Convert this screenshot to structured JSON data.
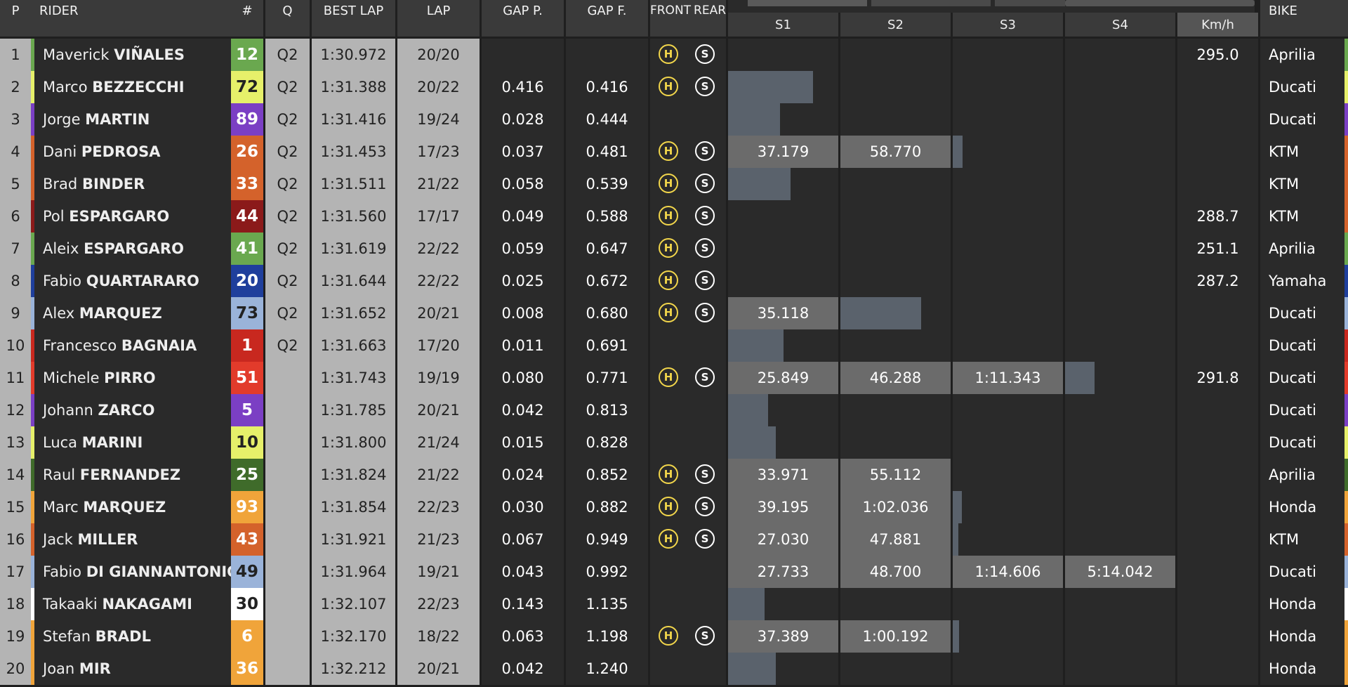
{
  "headers": {
    "p": "P",
    "rider": "RIDER",
    "num": "#",
    "q": "Q",
    "best_lap": "BEST LAP",
    "lap": "LAP",
    "gap_p": "GAP P.",
    "gap_f": "GAP F.",
    "front": "FRONT",
    "rear": "REAR",
    "s1": "S1",
    "s2": "S2",
    "s3": "S3",
    "s4": "S4",
    "kmh": "Km/h",
    "bike": "BIKE"
  },
  "rows": [
    {
      "pos": "1",
      "first": "Maverick",
      "last": "VIÑALES",
      "num": "12",
      "num_bg": "#6aa84f",
      "num_fg": "#ffffff",
      "team_color": "#6aa84f",
      "q": "Q2",
      "best": "1:30.972",
      "lap": "20/20",
      "gap_p": "",
      "gap_f": "",
      "front": "H",
      "rear": "S",
      "s1": "",
      "s2": "",
      "s3": "",
      "s4": "",
      "progress": [
        0,
        0,
        0,
        0
      ],
      "kmh": "295.0",
      "bike": "Aprilia",
      "end_color": "#6aa84f"
    },
    {
      "pos": "2",
      "first": "Marco",
      "last": "BEZZECCHI",
      "num": "72",
      "num_bg": "#e6f06a",
      "num_fg": "#222222",
      "team_color": "#e6f06a",
      "q": "Q2",
      "best": "1:31.388",
      "lap": "20/22",
      "gap_p": "0.416",
      "gap_f": "0.416",
      "front": "H",
      "rear": "S",
      "s1": "",
      "s2": "",
      "s3": "",
      "s4": "",
      "progress": [
        0.77,
        0,
        0,
        0
      ],
      "kmh": "",
      "bike": "Ducati",
      "end_color": "#e6f06a"
    },
    {
      "pos": "3",
      "first": "Jorge",
      "last": "MARTIN",
      "num": "89",
      "num_bg": "#7b3fc4",
      "num_fg": "#ffffff",
      "team_color": "#7b3fc4",
      "q": "Q2",
      "best": "1:31.416",
      "lap": "19/24",
      "gap_p": "0.028",
      "gap_f": "0.444",
      "front": "",
      "rear": "",
      "s1": "",
      "s2": "",
      "s3": "",
      "s4": "",
      "progress": [
        0.47,
        0,
        0,
        0
      ],
      "kmh": "",
      "bike": "Ducati",
      "end_color": "#7b3fc4"
    },
    {
      "pos": "4",
      "first": "Dani",
      "last": "PEDROSA",
      "num": "26",
      "num_bg": "#d4622b",
      "num_fg": "#ffffff",
      "team_color": "#d4622b",
      "q": "Q2",
      "best": "1:31.453",
      "lap": "17/23",
      "gap_p": "0.037",
      "gap_f": "0.481",
      "front": "H",
      "rear": "S",
      "s1": "37.179",
      "s2": "58.770",
      "s3": "",
      "s4": "",
      "progress": [
        1,
        1,
        0.09,
        0
      ],
      "kmh": "",
      "bike": "KTM",
      "end_color": "#d4622b"
    },
    {
      "pos": "5",
      "first": "Brad",
      "last": "BINDER",
      "num": "33",
      "num_bg": "#d4622b",
      "num_fg": "#ffffff",
      "team_color": "#d4622b",
      "q": "Q2",
      "best": "1:31.511",
      "lap": "21/22",
      "gap_p": "0.058",
      "gap_f": "0.539",
      "front": "H",
      "rear": "S",
      "s1": "",
      "s2": "",
      "s3": "",
      "s4": "",
      "progress": [
        0.57,
        0,
        0,
        0
      ],
      "kmh": "",
      "bike": "KTM",
      "end_color": "#d4622b"
    },
    {
      "pos": "6",
      "first": "Pol",
      "last": "ESPARGARO",
      "num": "44",
      "num_bg": "#8b1a1a",
      "num_fg": "#ffffff",
      "team_color": "#8b1a1a",
      "q": "Q2",
      "best": "1:31.560",
      "lap": "17/17",
      "gap_p": "0.049",
      "gap_f": "0.588",
      "front": "H",
      "rear": "S",
      "s1": "",
      "s2": "",
      "s3": "",
      "s4": "",
      "progress": [
        0,
        0,
        0,
        0
      ],
      "kmh": "288.7",
      "bike": "KTM",
      "end_color": "#d4622b"
    },
    {
      "pos": "7",
      "first": "Aleix",
      "last": "ESPARGARO",
      "num": "41",
      "num_bg": "#6aa84f",
      "num_fg": "#ffffff",
      "team_color": "#6aa84f",
      "q": "Q2",
      "best": "1:31.619",
      "lap": "22/22",
      "gap_p": "0.059",
      "gap_f": "0.647",
      "front": "H",
      "rear": "S",
      "s1": "",
      "s2": "",
      "s3": "",
      "s4": "",
      "progress": [
        0,
        0,
        0,
        0
      ],
      "kmh": "251.1",
      "bike": "Aprilia",
      "end_color": "#6aa84f"
    },
    {
      "pos": "8",
      "first": "Fabio",
      "last": "QUARTARARO",
      "num": "20",
      "num_bg": "#1f3f9c",
      "num_fg": "#ffffff",
      "team_color": "#1f3f9c",
      "q": "Q2",
      "best": "1:31.644",
      "lap": "22/22",
      "gap_p": "0.025",
      "gap_f": "0.672",
      "front": "H",
      "rear": "S",
      "s1": "",
      "s2": "",
      "s3": "",
      "s4": "",
      "progress": [
        0,
        0,
        0,
        0
      ],
      "kmh": "287.2",
      "bike": "Yamaha",
      "end_color": "#1f3f9c"
    },
    {
      "pos": "9",
      "first": "Alex",
      "last": "MARQUEZ",
      "num": "73",
      "num_bg": "#9ab3d9",
      "num_fg": "#222222",
      "team_color": "#9ab3d9",
      "q": "Q2",
      "best": "1:31.652",
      "lap": "20/21",
      "gap_p": "0.008",
      "gap_f": "0.680",
      "front": "H",
      "rear": "S",
      "s1": "35.118",
      "s2": "",
      "s3": "",
      "s4": "",
      "progress": [
        1,
        0.73,
        0,
        0
      ],
      "kmh": "",
      "bike": "Ducati",
      "end_color": "#9ab3d9"
    },
    {
      "pos": "10",
      "first": "Francesco",
      "last": "BAGNAIA",
      "num": "1",
      "num_bg": "#c8281f",
      "num_fg": "#ffffff",
      "team_color": "#c8281f",
      "q": "Q2",
      "best": "1:31.663",
      "lap": "17/20",
      "gap_p": "0.011",
      "gap_f": "0.691",
      "front": "",
      "rear": "",
      "s1": "",
      "s2": "",
      "s3": "",
      "s4": "",
      "progress": [
        0.5,
        0,
        0,
        0
      ],
      "kmh": "",
      "bike": "Ducati",
      "end_color": "#c8281f"
    },
    {
      "pos": "11",
      "first": "Michele",
      "last": "PIRRO",
      "num": "51",
      "num_bg": "#e23b2b",
      "num_fg": "#ffffff",
      "team_color": "#e23b2b",
      "q": "",
      "best": "1:31.743",
      "lap": "19/19",
      "gap_p": "0.080",
      "gap_f": "0.771",
      "front": "H",
      "rear": "S",
      "s1": "25.849",
      "s2": "46.288",
      "s3": "1:11.343",
      "s4": "",
      "progress": [
        1,
        1,
        1,
        0.27
      ],
      "kmh": "291.8",
      "bike": "Ducati",
      "end_color": "#e23b2b"
    },
    {
      "pos": "12",
      "first": "Johann",
      "last": "ZARCO",
      "num": "5",
      "num_bg": "#7b3fc4",
      "num_fg": "#ffffff",
      "team_color": "#7b3fc4",
      "q": "",
      "best": "1:31.785",
      "lap": "20/21",
      "gap_p": "0.042",
      "gap_f": "0.813",
      "front": "",
      "rear": "",
      "s1": "",
      "s2": "",
      "s3": "",
      "s4": "",
      "progress": [
        0.36,
        0,
        0,
        0
      ],
      "kmh": "",
      "bike": "Ducati",
      "end_color": "#7b3fc4"
    },
    {
      "pos": "13",
      "first": "Luca",
      "last": "MARINI",
      "num": "10",
      "num_bg": "#e6f06a",
      "num_fg": "#222222",
      "team_color": "#e6f06a",
      "q": "",
      "best": "1:31.800",
      "lap": "21/24",
      "gap_p": "0.015",
      "gap_f": "0.828",
      "front": "",
      "rear": "",
      "s1": "",
      "s2": "",
      "s3": "",
      "s4": "",
      "progress": [
        0.43,
        0,
        0,
        0
      ],
      "kmh": "",
      "bike": "Ducati",
      "end_color": "#e6f06a"
    },
    {
      "pos": "14",
      "first": "Raul",
      "last": "FERNANDEZ",
      "num": "25",
      "num_bg": "#3f6b2a",
      "num_fg": "#ffffff",
      "team_color": "#3f6b2a",
      "q": "",
      "best": "1:31.824",
      "lap": "21/22",
      "gap_p": "0.024",
      "gap_f": "0.852",
      "front": "H",
      "rear": "S",
      "s1": "33.971",
      "s2": "55.112",
      "s3": "",
      "s4": "",
      "progress": [
        1,
        1,
        0,
        0
      ],
      "kmh": "",
      "bike": "Aprilia",
      "end_color": "#3f6b2a"
    },
    {
      "pos": "15",
      "first": "Marc",
      "last": "MARQUEZ",
      "num": "93",
      "num_bg": "#f0a43a",
      "num_fg": "#ffffff",
      "team_color": "#f0a43a",
      "q": "",
      "best": "1:31.854",
      "lap": "22/23",
      "gap_p": "0.030",
      "gap_f": "0.882",
      "front": "H",
      "rear": "S",
      "s1": "39.195",
      "s2": "1:02.036",
      "s3": "",
      "s4": "",
      "progress": [
        1,
        1,
        0.08,
        0
      ],
      "kmh": "",
      "bike": "Honda",
      "end_color": "#f0a43a"
    },
    {
      "pos": "16",
      "first": "Jack",
      "last": "MILLER",
      "num": "43",
      "num_bg": "#d4622b",
      "num_fg": "#ffffff",
      "team_color": "#d4622b",
      "q": "",
      "best": "1:31.921",
      "lap": "21/23",
      "gap_p": "0.067",
      "gap_f": "0.949",
      "front": "H",
      "rear": "S",
      "s1": "27.030",
      "s2": "47.881",
      "s3": "",
      "s4": "",
      "progress": [
        1,
        1,
        0.05,
        0
      ],
      "kmh": "",
      "bike": "KTM",
      "end_color": "#d4622b"
    },
    {
      "pos": "17",
      "first": "Fabio",
      "last": "DI GIANNANTONIO",
      "num": "49",
      "num_bg": "#9ab3d9",
      "num_fg": "#222222",
      "team_color": "#9ab3d9",
      "q": "",
      "best": "1:31.964",
      "lap": "19/21",
      "gap_p": "0.043",
      "gap_f": "0.992",
      "front": "",
      "rear": "",
      "s1": "27.733",
      "s2": "48.700",
      "s3": "1:14.606",
      "s4": "5:14.042",
      "progress": [
        1,
        1,
        1,
        1
      ],
      "kmh": "",
      "bike": "Ducati",
      "end_color": "#9ab3d9"
    },
    {
      "pos": "18",
      "first": "Takaaki",
      "last": "NAKAGAMI",
      "num": "30",
      "num_bg": "#ffffff",
      "num_fg": "#222222",
      "team_color": "#ffffff",
      "q": "",
      "best": "1:32.107",
      "lap": "22/23",
      "gap_p": "0.143",
      "gap_f": "1.135",
      "front": "",
      "rear": "",
      "s1": "",
      "s2": "",
      "s3": "",
      "s4": "",
      "progress": [
        0.33,
        0,
        0,
        0
      ],
      "kmh": "",
      "bike": "Honda",
      "end_color": "#ffffff"
    },
    {
      "pos": "19",
      "first": "Stefan",
      "last": "BRADL",
      "num": "6",
      "num_bg": "#f0a43a",
      "num_fg": "#ffffff",
      "team_color": "#f0a43a",
      "q": "",
      "best": "1:32.170",
      "lap": "18/22",
      "gap_p": "0.063",
      "gap_f": "1.198",
      "front": "H",
      "rear": "S",
      "s1": "37.389",
      "s2": "1:00.192",
      "s3": "",
      "s4": "",
      "progress": [
        1,
        1,
        0.06,
        0
      ],
      "kmh": "",
      "bike": "Honda",
      "end_color": "#f0a43a"
    },
    {
      "pos": "20",
      "first": "Joan",
      "last": "MIR",
      "num": "36",
      "num_bg": "#f0a43a",
      "num_fg": "#ffffff",
      "team_color": "#f0a43a",
      "q": "",
      "best": "1:32.212",
      "lap": "20/21",
      "gap_p": "0.042",
      "gap_f": "1.240",
      "front": "",
      "rear": "",
      "s1": "",
      "s2": "",
      "s3": "",
      "s4": "",
      "progress": [
        0.43,
        0,
        0,
        0
      ],
      "kmh": "",
      "bike": "Honda",
      "end_color": "#f0a43a"
    }
  ]
}
